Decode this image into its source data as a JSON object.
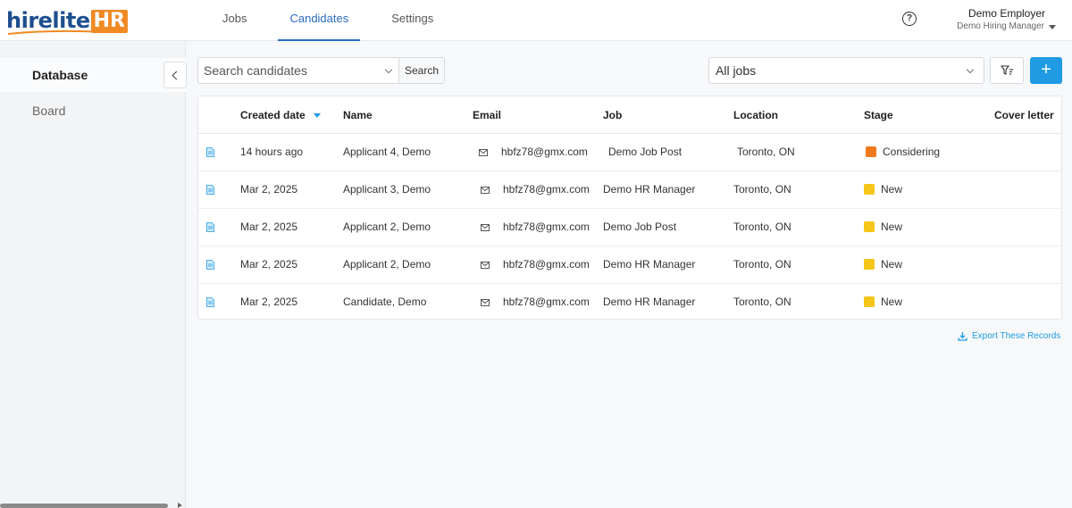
{
  "brand": {
    "logo_text": "hirelite",
    "logo_hr": "HR",
    "accent": "#1e9be3",
    "logo_blue": "#1e4f8f",
    "logo_orange": "#f08a24"
  },
  "nav": {
    "tabs": [
      {
        "label": "Jobs"
      },
      {
        "label": "Candidates",
        "active": true
      },
      {
        "label": "Settings"
      }
    ]
  },
  "header": {
    "help_icon": "question-circle-icon",
    "user_name": "Demo Employer",
    "user_role": "Demo Hiring Manager"
  },
  "sidebar": {
    "items": [
      {
        "label": "Database",
        "active": true
      },
      {
        "label": "Board"
      }
    ],
    "collapse_icon": "chevron-left-icon"
  },
  "toolbar": {
    "search_placeholder": "Search candidates",
    "search_button": "Search",
    "jobs_filter_value": "All jobs",
    "filter_icon": "filter-icon",
    "add_label": "+"
  },
  "table": {
    "columns": [
      "Created date",
      "Name",
      "Email",
      "Job",
      "Location",
      "Stage",
      "Cover letter"
    ],
    "sort_column": "Created date",
    "rows": [
      {
        "created": "14 hours ago",
        "name": "Applicant 4, Demo",
        "email": "hbfz78@gmx.com",
        "job": "Demo Job Post",
        "location": "Toronto, ON",
        "stage": "Considering",
        "stage_color": "#f07a1e"
      },
      {
        "created": "Mar 2, 2025",
        "name": "Applicant 3, Demo",
        "email": "hbfz78@gmx.com",
        "job": "Demo HR Manager",
        "location": "Toronto, ON",
        "stage": "New",
        "stage_color": "#f5c518"
      },
      {
        "created": "Mar 2, 2025",
        "name": "Applicant 2, Demo",
        "email": "hbfz78@gmx.com",
        "job": "Demo Job Post",
        "location": "Toronto, ON",
        "stage": "New",
        "stage_color": "#f5c518"
      },
      {
        "created": "Mar 2, 2025",
        "name": "Applicant 2, Demo",
        "email": "hbfz78@gmx.com",
        "job": "Demo HR Manager",
        "location": "Toronto, ON",
        "stage": "New",
        "stage_color": "#f5c518"
      },
      {
        "created": "Mar 2, 2025",
        "name": "Candidate, Demo",
        "email": "hbfz78@gmx.com",
        "job": "Demo HR Manager",
        "location": "Toronto, ON",
        "stage": "New",
        "stage_color": "#f5c518"
      }
    ]
  },
  "export_label": "Export These Records"
}
